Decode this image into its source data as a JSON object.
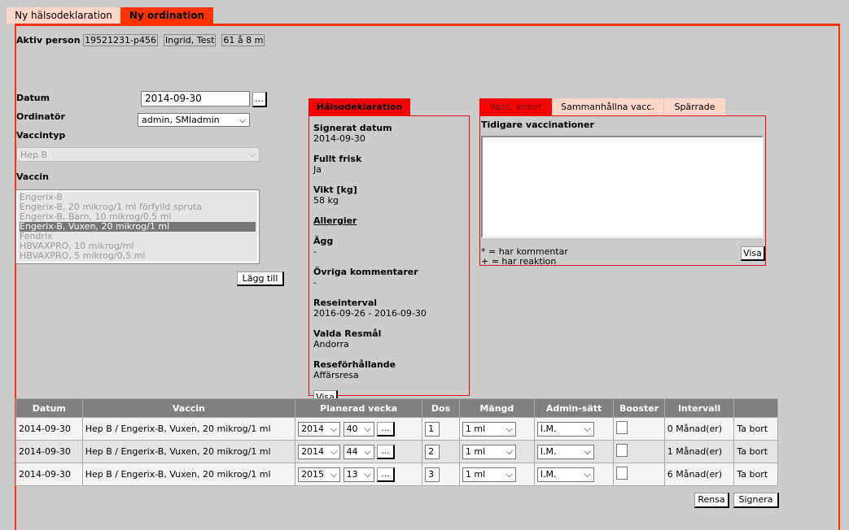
{
  "tabs": [
    {
      "label": "Ny hälsodeklaration",
      "active": false
    },
    {
      "label": "Ny ordination",
      "active": true
    }
  ],
  "colors": {
    "accent": "#ff3300",
    "panel_red": "#ff0000",
    "tab_inactive": "#ffd5c8",
    "table_header": "#808080"
  },
  "person": {
    "label": "Aktiv person",
    "id": "19521231-p456",
    "name": "Ingrid, Test",
    "age": "61 å 8 m"
  },
  "form": {
    "datum_label": "Datum",
    "datum_value": "2014-09-30",
    "picker": "...",
    "ordinator_label": "Ordinatör",
    "ordinator_value": "admin, SMIadmin",
    "vaccintyp_label": "Vaccintyp",
    "vaccintyp_value": "Hep B",
    "vaccin_label": "Vaccin",
    "vaccin_options": [
      "Engerix-B",
      "Engerix-B, 20 mikrog/1 ml förfylld spruta",
      "Engerix-B, Barn, 10 mikrog/0,5 ml",
      "Engerix-B, Vuxen, 20 mikrog/1 ml",
      "Fendrix",
      "HBVAXPRO, 10 mikrog/ml",
      "HBVAXPRO, 5 mikrog/0,5 ml"
    ],
    "vaccin_selected": "Engerix-B, Vuxen, 20 mikrog/1 ml",
    "add_button": "Lägg till"
  },
  "health": {
    "tab": "Hälsodeklaration",
    "fields": [
      {
        "label": "Signerat datum",
        "value": "2014-09-30"
      },
      {
        "label": "Fullt frisk",
        "value": "Ja"
      },
      {
        "label": "Vikt [kg]",
        "value": "58 kg"
      }
    ],
    "allergier": "Allergier",
    "fields2": [
      {
        "label": "Ägg",
        "value": "-"
      },
      {
        "label": "Övriga kommentarer",
        "value": "-"
      },
      {
        "label": "Reseinterval",
        "value": "2016-09-26 - 2016-09-30"
      },
      {
        "label": "Valda Resmål",
        "value": "Andorra"
      },
      {
        "label": "Reseförhållande",
        "value": "Affärsresa"
      }
    ],
    "visa": "Visa"
  },
  "vacc": {
    "tabs": [
      "Vacc. enhet",
      "Sammanhållna vacc.",
      "Spärrade"
    ],
    "title": "Tidigare vaccinationer",
    "legend1": "* = har kommentar",
    "legend2": "+ = har reaktion",
    "visa": "Visa"
  },
  "table": {
    "headers": [
      "Datum",
      "Vaccin",
      "Planerad vecka",
      "Dos",
      "Mängd",
      "Admin-sätt",
      "Booster",
      "Intervall",
      ""
    ],
    "rows": [
      {
        "datum": "2014-09-30",
        "vaccin": "Hep B / Engerix-B, Vuxen, 20 mikrog/1 ml",
        "year": "2014",
        "week": "40",
        "dos": "1",
        "mangd": "1 ml",
        "admin": "I.M.",
        "booster": false,
        "intervall": "0 Månad(er)",
        "remove": "Ta bort"
      },
      {
        "datum": "2014-09-30",
        "vaccin": "Hep B / Engerix-B, Vuxen, 20 mikrog/1 ml",
        "year": "2014",
        "week": "44",
        "dos": "2",
        "mangd": "1 ml",
        "admin": "I.M.",
        "booster": false,
        "intervall": "1 Månad(er)",
        "remove": "Ta bort"
      },
      {
        "datum": "2014-09-30",
        "vaccin": "Hep B / Engerix-B, Vuxen, 20 mikrog/1 ml",
        "year": "2015",
        "week": "13",
        "dos": "3",
        "mangd": "1 ml",
        "admin": "I.M.",
        "booster": false,
        "intervall": "6 Månad(er)",
        "remove": "Ta bort"
      }
    ]
  },
  "footer": {
    "rensa": "Rensa",
    "signera": "Signera"
  }
}
